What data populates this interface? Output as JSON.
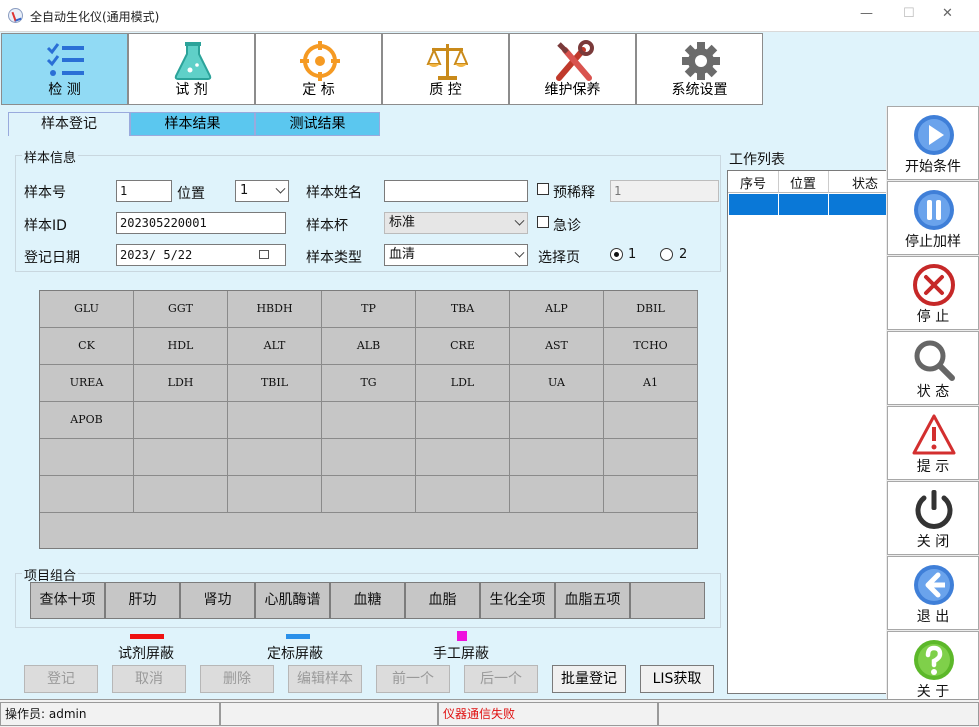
{
  "window": {
    "title": "全自动生化仪(通用模式)",
    "min_glyph": "—",
    "max_glyph": "☐",
    "close_glyph": "✕"
  },
  "toolbar": [
    {
      "label": "检 测",
      "icon": "checklist-icon",
      "active": true
    },
    {
      "label": "试 剂",
      "icon": "flask-icon",
      "active": false
    },
    {
      "label": "定 标",
      "icon": "crosshair-icon",
      "active": false
    },
    {
      "label": "质 控",
      "icon": "balance-scale-icon",
      "active": false
    },
    {
      "label": "维护保养",
      "icon": "tools-icon",
      "active": false
    },
    {
      "label": "系统设置",
      "icon": "gear-icon",
      "active": false
    }
  ],
  "tabs": [
    "样本登记",
    "样本结果",
    "测试结果"
  ],
  "sample_info": {
    "group_title": "样本信息",
    "sample_no_label": "样本号",
    "sample_no": "1",
    "position_label": "位置",
    "position": "1",
    "name_label": "样本姓名",
    "name": "",
    "predilute_label": "预稀释",
    "predilute": "1",
    "sample_id_label": "样本ID",
    "sample_id": "202305220001",
    "cup_label": "样本杯",
    "cup": "标准",
    "urgent_label": "急诊",
    "date_label": "登记日期",
    "date": "2023/ 5/22",
    "type_label": "样本类型",
    "type": "血清",
    "page_label": "选择页",
    "page_options": [
      "1",
      "2"
    ],
    "page_selected": "1"
  },
  "test_grid": [
    [
      "GLU",
      "GGT",
      "HBDH",
      "TP",
      "TBA",
      "ALP",
      "DBIL"
    ],
    [
      "CK",
      "HDL",
      "ALT",
      "ALB",
      "CRE",
      "AST",
      "TCHO"
    ],
    [
      "UREA",
      "LDH",
      "TBIL",
      "TG",
      "LDL",
      "UA",
      "A1"
    ],
    [
      "APOB",
      "",
      "",
      "",
      "",
      "",
      ""
    ],
    [
      "",
      "",
      "",
      "",
      "",
      "",
      ""
    ],
    [
      "",
      "",
      "",
      "",
      "",
      "",
      ""
    ]
  ],
  "combos": {
    "group_title": "项目组合",
    "items": [
      "查体十项",
      "肝功",
      "肾功",
      "心肌酶谱",
      "血糖",
      "血脂",
      "生化全项",
      "血脂五项",
      ""
    ]
  },
  "legend": [
    {
      "label": "试剂屏蔽",
      "color": "#ee1111"
    },
    {
      "label": "定标屏蔽",
      "color": "#2a90ea"
    },
    {
      "label": "手工屏蔽",
      "color": "#ee11dd"
    }
  ],
  "actions": [
    {
      "label": "登记",
      "enabled": false
    },
    {
      "label": "取消",
      "enabled": false
    },
    {
      "label": "删除",
      "enabled": false
    },
    {
      "label": "编辑样本",
      "enabled": false
    },
    {
      "label": "前一个",
      "enabled": false
    },
    {
      "label": "后一个",
      "enabled": false
    },
    {
      "label": "批量登记",
      "enabled": true
    },
    {
      "label": "LIS获取",
      "enabled": true
    }
  ],
  "worklist": {
    "title": "工作列表",
    "columns": [
      "序号",
      "位置",
      "状态"
    ]
  },
  "sidebar": [
    {
      "label": "开始条件",
      "icon": "play-icon"
    },
    {
      "label": "停止加样",
      "icon": "pause-icon"
    },
    {
      "label": "停 止",
      "icon": "stop-icon"
    },
    {
      "label": "状 态",
      "icon": "magnifier-icon"
    },
    {
      "label": "提 示",
      "icon": "warning-icon"
    },
    {
      "label": "关 闭",
      "icon": "power-icon"
    },
    {
      "label": "退 出",
      "icon": "back-arrow-icon"
    },
    {
      "label": "关 于",
      "icon": "help-icon"
    }
  ],
  "status": {
    "operator": "操作员: admin",
    "message": "仪器通信失败"
  },
  "colors": {
    "accent": "#91daf4",
    "tab_inactive": "#5bc7ef",
    "selection": "#0a78d7",
    "error_text": "#e01010"
  }
}
